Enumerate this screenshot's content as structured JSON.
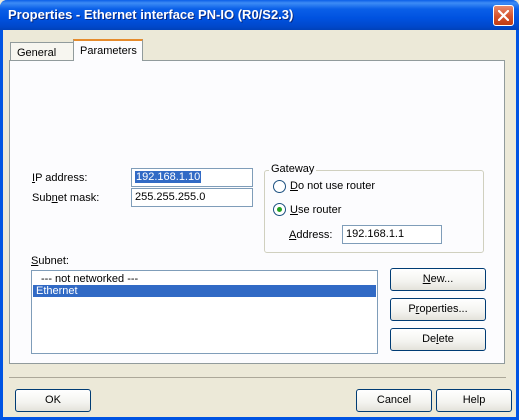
{
  "window": {
    "title": "Properties - Ethernet interface  PN-IO (R0/S2.3)"
  },
  "tabs": [
    {
      "label": "General"
    },
    {
      "label": "Parameters"
    }
  ],
  "ip": {
    "label_key": "I",
    "label_rest": "P address:",
    "value": "192.168.1.10"
  },
  "subnet_mask": {
    "label_pre": "Sub",
    "label_key": "n",
    "label_post": "et mask:",
    "value": "255.255.255.0"
  },
  "gateway": {
    "title": "Gateway",
    "option_no_router": {
      "key": "D",
      "rest": "o not use router",
      "checked": false
    },
    "option_use_router": {
      "key": "U",
      "rest": "se router",
      "checked": true
    },
    "address_label_key": "A",
    "address_label_rest": "ddress:",
    "address_value": "192.168.1.1"
  },
  "subnet": {
    "label_key": "S",
    "label_rest": "ubnet:",
    "items": [
      "--- not networked ---",
      "Ethernet"
    ],
    "selected_index": 1
  },
  "side_buttons": {
    "new_key": "N",
    "new_rest": "ew...",
    "properties_pre": "P",
    "properties_key": "r",
    "properties_post": "operties...",
    "delete_pre": "De",
    "delete_key": "l",
    "delete_post": "ete"
  },
  "footer": {
    "ok": "OK",
    "cancel": "Cancel",
    "help": "Help"
  },
  "colors": {
    "titlebar": "#0a5fe8",
    "selection": "#316ac5",
    "active_tab_accent": "#e68b2c",
    "dialog_bg": "#ece9d8"
  }
}
